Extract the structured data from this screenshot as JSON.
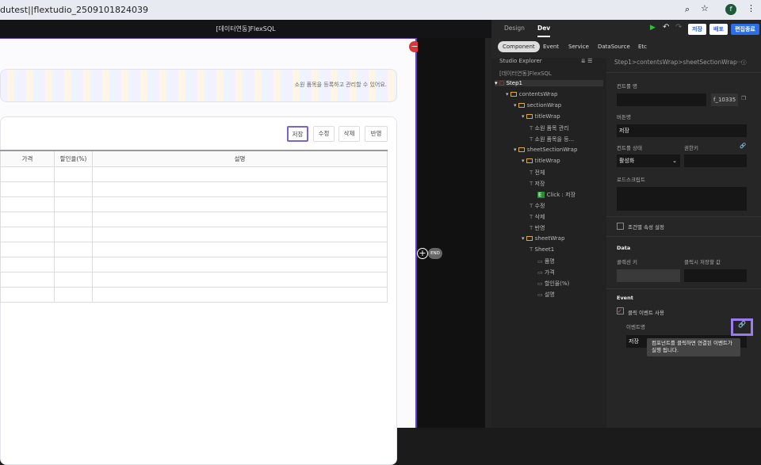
{
  "browser": {
    "url": "dutest||flextudio_2509101824039"
  },
  "app": {
    "title": "[데이터연동]FlexSQL",
    "end_label": "END"
  },
  "canvas": {
    "banner_text": "소원 품목을 등록하고 관리할 수 있어요.",
    "buttons": [
      "저장",
      "수정",
      "삭제",
      "반영"
    ],
    "columns": [
      "가격",
      "할인율(%)",
      "설명"
    ],
    "row_count": 9
  },
  "header": {
    "tabs": [
      "Design",
      "Dev"
    ],
    "save": "저장",
    "deploy": "배포",
    "finish": "편집종료"
  },
  "subtabs": [
    "Component",
    "Event",
    "Service",
    "DataSource",
    "Etc"
  ],
  "explorer": {
    "title": "Studio Explorer",
    "project": "[데이터연동]FlexSQL",
    "nodes": [
      {
        "label": "Step1",
        "depth": 0
      },
      {
        "label": "contentsWrap",
        "depth": 1
      },
      {
        "label": "sectionWrap",
        "depth": 2
      },
      {
        "label": "titleWrap",
        "depth": 3
      },
      {
        "label": "소원 품목 관리",
        "depth": 4
      },
      {
        "label": "소원 품목을 등...",
        "depth": 4
      },
      {
        "label": "sheetSectionWrap",
        "depth": 2
      },
      {
        "label": "titleWrap",
        "depth": 3
      },
      {
        "label": "전체",
        "depth": 4
      },
      {
        "label": "저장",
        "depth": 4
      },
      {
        "label": "Click : 저장",
        "depth": 5
      },
      {
        "label": "수정",
        "depth": 4
      },
      {
        "label": "삭제",
        "depth": 4
      },
      {
        "label": "반영",
        "depth": 4
      },
      {
        "label": "sheetWrap",
        "depth": 3
      },
      {
        "label": "Sheet1",
        "depth": 4
      },
      {
        "label": "품명",
        "depth": 5
      },
      {
        "label": "가격",
        "depth": 5
      },
      {
        "label": "할인율(%)",
        "depth": 5
      },
      {
        "label": "설명",
        "depth": 5
      }
    ]
  },
  "props": {
    "breadcrumb": "Step1>contentsWrap>sheetSectionWrap···",
    "control_name_label": "컨트롤 명",
    "control_id": "f_10335",
    "button_name_label": "버튼명",
    "button_name": "저장",
    "state_label": "컨트롤 상태",
    "state_value": "활성화",
    "perm_label": "권한키",
    "load_script_label": "로드스크립트",
    "conditional_label": "조건별 속성 설정",
    "data_title": "Data",
    "collection_key_label": "콜렉션 키",
    "click_value_label": "클릭시 저장할 값",
    "event_title": "Event",
    "click_event_label": "클릭 이벤트 사용",
    "event_name_label": "이벤트명",
    "event_value": "저장",
    "tooltip": "컴포넌트를 클릭하면 연결된 이벤트가 실행 됩니다."
  }
}
